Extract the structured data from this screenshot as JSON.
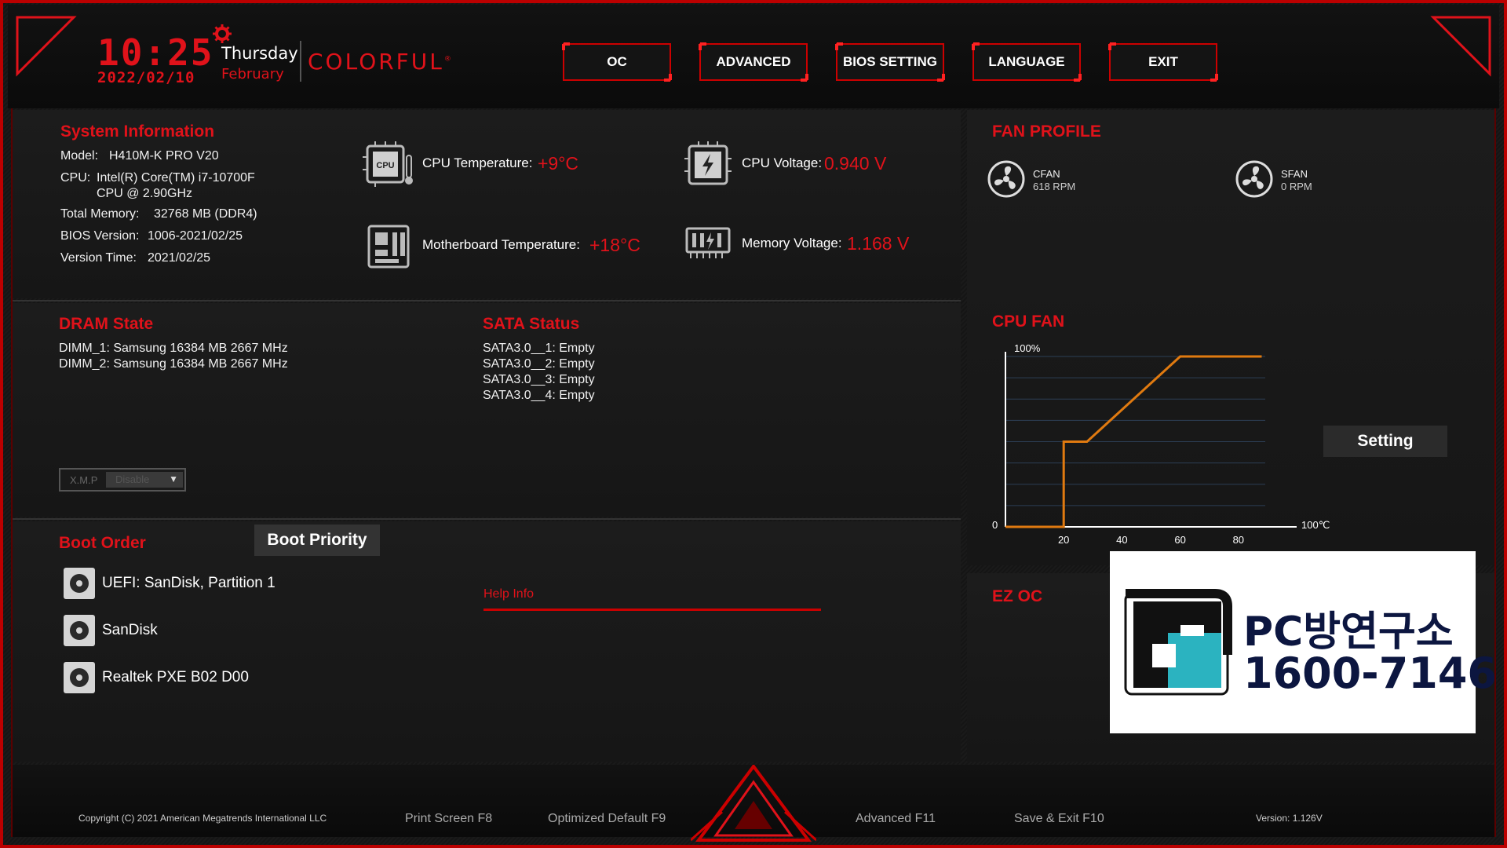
{
  "header": {
    "time": "10:25",
    "date": "2022/02/10",
    "day": "Thursday",
    "month": "February",
    "brand": "COLORFUL",
    "brand_mark": "®"
  },
  "nav": {
    "items": [
      {
        "label": "OC"
      },
      {
        "label": "ADVANCED"
      },
      {
        "label": "BIOS SETTING"
      },
      {
        "label": "LANGUAGE"
      },
      {
        "label": "EXIT"
      }
    ]
  },
  "system_info": {
    "title": "System Information",
    "model_label": "Model:",
    "model_value": "H410M-K PRO V20",
    "cpu_label": "CPU:",
    "cpu_value_line1": "Intel(R) Core(TM) i7-10700F",
    "cpu_value_line2": "CPU @ 2.90GHz",
    "memory_label": "Total Memory:",
    "memory_value": "32768 MB (DDR4)",
    "bios_label": "BIOS Version:",
    "bios_value": "1006-2021/02/25",
    "version_time_label": "Version Time:",
    "version_time_value": "2021/02/25"
  },
  "sensors": {
    "cpu_temp_label": "CPU Temperature:",
    "cpu_temp_value": "+9°C",
    "mb_temp_label": "Motherboard Temperature:",
    "mb_temp_value": "+18°C",
    "cpu_voltage_label": "CPU Voltage:",
    "cpu_voltage_value": "0.940 V",
    "mem_voltage_label": "Memory Voltage:",
    "mem_voltage_value": "1.168 V",
    "cpu_chip_text": "CPU"
  },
  "dram": {
    "title": "DRAM State",
    "slots": [
      "DIMM_1: Samsung 16384 MB 2667 MHz",
      "DIMM_2: Samsung 16384 MB 2667 MHz"
    ],
    "xmp_label": "X.M.P",
    "xmp_value": "Disable"
  },
  "sata": {
    "title": "SATA Status",
    "ports": [
      "SATA3.0__1: Empty",
      "SATA3.0__2: Empty",
      "SATA3.0__3: Empty",
      "SATA3.0__4: Empty"
    ]
  },
  "boot": {
    "title": "Boot Order",
    "priority_button": "Boot Priority",
    "devices": [
      "UEFI: SanDisk, Partition 1",
      "SanDisk",
      "Realtek PXE B02 D00"
    ]
  },
  "help": {
    "title": "Help Info"
  },
  "fan_profile": {
    "title": "FAN PROFILE",
    "fans": [
      {
        "name": "CFAN",
        "rpm": "618 RPM"
      },
      {
        "name": "SFAN",
        "rpm": "0 RPM"
      }
    ]
  },
  "cpu_fan": {
    "title": "CPU FAN",
    "setting_button": "Setting",
    "y_max_label": "100%",
    "y_zero_label": "0",
    "x_max_label": "100℃",
    "x_ticks": [
      "20",
      "40",
      "60",
      "80"
    ]
  },
  "chart_data": {
    "type": "line",
    "title": "CPU FAN",
    "xlabel": "",
    "ylabel": "",
    "x_unit": "℃",
    "y_unit": "%",
    "xlim": [
      0,
      100
    ],
    "ylim": [
      0,
      100
    ],
    "x_ticks": [
      20,
      40,
      60,
      80
    ],
    "series": [
      {
        "x": [
          0,
          20,
          20,
          28,
          60,
          88
        ],
        "y": [
          0,
          0,
          50,
          50,
          100,
          100
        ]
      }
    ],
    "grid": true,
    "color": "#e07a10"
  },
  "ez_oc": {
    "title": "EZ OC"
  },
  "watermark": {
    "line1": "PC방연구소",
    "line2": "1600-7146"
  },
  "footer": {
    "copyright": "Copyright (C) 2021 American Megatrends International LLC",
    "print_screen": "Print Screen F8",
    "optimized_default": "Optimized Default F9",
    "advanced": "Advanced F11",
    "save_exit": "Save & Exit F10",
    "version": "Version: 1.126V"
  },
  "colors": {
    "accent": "#e0121a",
    "chart_line": "#e07a10",
    "background": "#151515"
  }
}
